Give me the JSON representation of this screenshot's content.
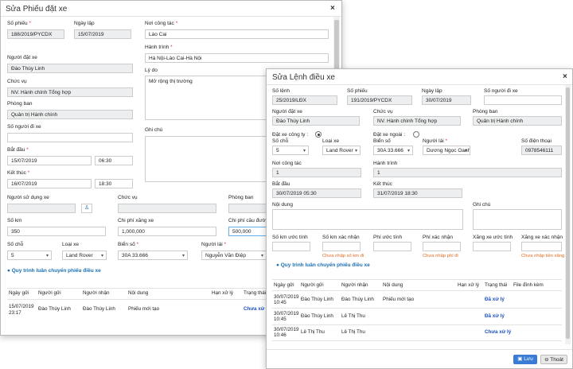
{
  "back": {
    "title": "Sửa Phiếu đặt xe",
    "labels": {
      "so_phieu": "Số phiếu",
      "ngay_lap": "Ngày lập",
      "noi_cong_tac": "Nơi công tác",
      "hanh_trinh": "Hành trình",
      "ly_do": "Lý do",
      "nguoi_dat_xe": "Người đặt xe",
      "chuc_vu": "Chức vụ",
      "phong_ban": "Phòng ban",
      "so_nguoi_di_xe": "Số người đi xe",
      "ghi_chu": "Ghi chú",
      "bat_dau": "Bắt đầu",
      "ket_thuc": "Kết thúc",
      "nguoi_su_dung_xe": "Người sử dụng xe",
      "chuc_vu2": "Chức vụ",
      "phong_ban2": "Phòng ban",
      "so_km": "Số km",
      "chi_phi_xang_xe": "Chi phí xăng xe",
      "chi_phi_cau_duong": "Chi phí cầu đườ",
      "so_cho": "Số chỗ",
      "loai_xe": "Loại xe",
      "bien_so": "Biển số",
      "nguoi_lai": "Người lái"
    },
    "values": {
      "so_phieu": "188/2019/PYCDX",
      "ngay_lap": "15/07/2019",
      "noi_cong_tac": "Lào Cai",
      "hanh_trinh": "Hà Nội-Lào Cai-Hà Nội",
      "ly_do": "Mở rộng thị trường",
      "nguoi_dat_xe": "Đào Thùy Linh",
      "chuc_vu": "NV. Hành chính Tổng hợp",
      "phong_ban": "Quản trị Hành chính",
      "so_nguoi_di_xe": "",
      "bat_dau_date": "15/07/2019",
      "bat_dau_time": "06:30",
      "ket_thuc_date": "16/07/2019",
      "ket_thuc_time": "18:30",
      "so_km": "350",
      "chi_phi_xang_xe": "1,000,000",
      "chi_phi_cau_duong": "500,000",
      "so_cho": "5",
      "loai_xe": "Land Rover",
      "bien_so": "30A 33.666",
      "nguoi_lai": "Nguyễn Văn Điệp"
    },
    "section_title": "Quy trình luân chuyển phiếu điều xe",
    "table": {
      "headers": [
        "Ngày gửi",
        "Người gửi",
        "Người nhận",
        "Nội dung",
        "Hạn xử lý",
        "Trạng thái"
      ],
      "rows": [
        {
          "ngay": "15/07/2019",
          "gio": "23:17",
          "gui": "Đào Thùy Linh",
          "nhan": "Đào Thùy Linh",
          "noi_dung": "Phiếu mới tạo",
          "han": "",
          "trang_thai": "Chưa xử lý"
        }
      ]
    }
  },
  "front": {
    "title": "Sửa Lệnh điều xe",
    "labels": {
      "so_lenh": "Số lệnh",
      "so_phieu": "Số phiếu",
      "ngay_lap": "Ngày lập",
      "so_nguoi_di_xe": "Số người đi xe",
      "nguoi_dat_xe": "Người đặt xe",
      "chuc_vu": "Chức vụ",
      "phong_ban": "Phòng ban",
      "dat_xe_cong_ty": "Đặt xe công ty :",
      "dat_xe_ngoai": "Đặt xe ngoài :",
      "so_cho": "Số chỗ",
      "loai_xe": "Loại xe",
      "bien_so": "Biển số",
      "nguoi_lai": "Người lái",
      "so_dien_thoai": "Số điện thoại",
      "noi_cong_tac": "Nơi công tác",
      "hanh_trinh": "Hành trình",
      "bat_dau": "Bắt đầu",
      "ket_thuc": "Kết thúc",
      "noi_dung": "Nội dung",
      "ghi_chu": "Ghi chú",
      "so_km_uoc_tinh": "Số km ước tính",
      "so_km_xac_nhan": "Số km xác nhận",
      "phi_uoc_tinh": "Phí ước tính",
      "phi_xac_nhan": "Phí xác nhận",
      "xang_xe_uoc_tinh": "Xăng xe ước tính",
      "xang_xe_xac_nhan": "Xăng xe xác nhận"
    },
    "values": {
      "so_lenh": "25/2019/LĐX",
      "so_phieu": "191/2019/PYCDX",
      "ngay_lap": "30/07/2019",
      "so_nguoi_di_xe": "",
      "nguoi_dat_xe": "Đào Thùy Linh",
      "chuc_vu": "NV. Hành chính Tổng hợp",
      "phong_ban": "Quản trị Hành chính",
      "so_cho": "5",
      "loai_xe": "Land Rover",
      "bien_so": "30A 33.666",
      "nguoi_lai": "Dương Ngọc Oanh",
      "so_dien_thoai": "0978546111",
      "noi_cong_tac": "1",
      "hanh_trinh": "1",
      "bat_dau": "30/07/2019 05:30",
      "ket_thuc": "31/07/2019 18:30"
    },
    "notes": {
      "km": "Chưa nhập số km đi",
      "phi": "Chưa nhập phí đi",
      "xang": "Chưa nhập tiền xăng"
    },
    "section_title": "Quy trình luân chuyển phiếu điều xe",
    "table": {
      "headers": [
        "Ngày gửi",
        "Người gửi",
        "Người nhận",
        "Nội dung",
        "Hạn xử lý",
        "Trạng thái",
        "File đính kèm"
      ],
      "rows": [
        {
          "ngay": "30/07/2019",
          "gio": "10:45",
          "gui": "Đào Thùy Linh",
          "nhan": "Đào Thùy Linh",
          "noi_dung": "Phiếu mới tạo",
          "trang_thai": "Đã xử lý"
        },
        {
          "ngay": "30/07/2019",
          "gio": "10:45",
          "gui": "Đào Thùy Linh",
          "nhan": "Lê Thị Thu",
          "noi_dung": "",
          "trang_thai": "Đã xử lý"
        },
        {
          "ngay": "30/07/2019",
          "gio": "10:46",
          "gui": "Lê Thị Thu",
          "nhan": "Lê Thị Thu",
          "noi_dung": "",
          "trang_thai": "Chưa xử lý"
        }
      ]
    },
    "buttons": {
      "save": "Lưu",
      "exit": "Thoát"
    }
  }
}
